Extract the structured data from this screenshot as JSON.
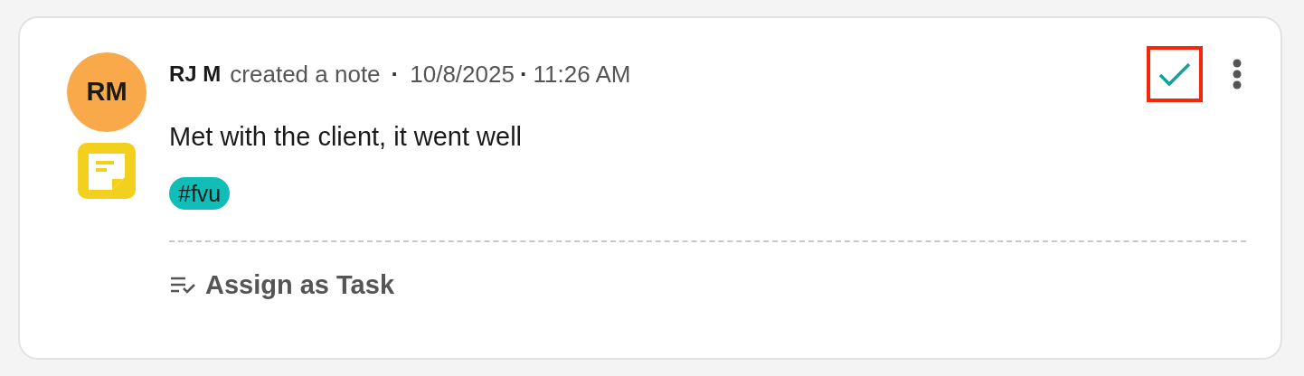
{
  "note": {
    "avatar": {
      "initials": "RM"
    },
    "author": "RJ M",
    "action": "created a note",
    "date": "10/8/2025",
    "time": "11:26 AM",
    "separator": "·",
    "body": "Met with the client, it went well",
    "tags": [
      {
        "label": "#fvu",
        "color": "#10bdb7"
      }
    ],
    "complete_button": {
      "highlighted": true
    },
    "assign_task": {
      "label": "Assign as Task"
    }
  }
}
